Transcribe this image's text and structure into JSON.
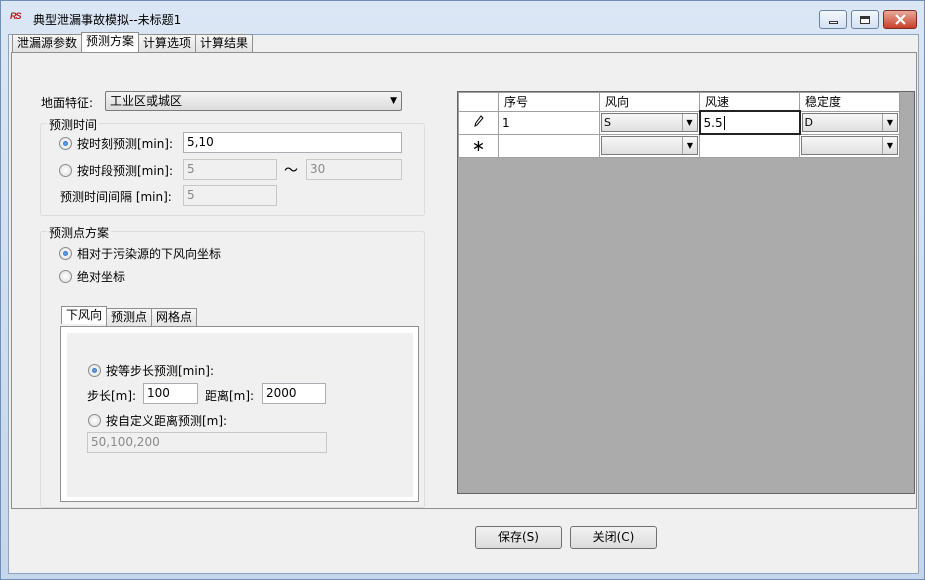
{
  "window": {
    "title": "典型泄漏事故模拟--未标题1",
    "app_icon_text": "RS",
    "controls": {
      "minimize": "minimize-icon",
      "maximize": "maximize-icon",
      "close": "close-icon"
    }
  },
  "tabs": [
    {
      "label": "泄漏源参数"
    },
    {
      "label": "预测方案"
    },
    {
      "label": "计算选项"
    },
    {
      "label": "计算结果"
    }
  ],
  "ground": {
    "label": "地面特征:",
    "value": "工业区或城区"
  },
  "time_group": {
    "title": "预测时间",
    "at_time": {
      "label": "按时刻预测[min]:",
      "value": "5,10",
      "checked": true
    },
    "period": {
      "label": "按时段预测[min]:",
      "from": "5",
      "tilde": "～",
      "to": "30"
    },
    "interval": {
      "label": "预测时间间隔 [min]:",
      "value": "5"
    }
  },
  "point_group": {
    "title": "预测点方案",
    "relative": {
      "label": "相对于污染源的下风向坐标",
      "checked": true
    },
    "absolute": {
      "label": "绝对坐标"
    }
  },
  "inner_tabs": [
    {
      "label": "下风向"
    },
    {
      "label": "预测点"
    },
    {
      "label": "网格点"
    }
  ],
  "downwind": {
    "equal_step": {
      "label": "按等步长预测[min]:",
      "checked": true
    },
    "step_label": "步长[m]:",
    "step_value": "100",
    "distance_label": "距离[m]:",
    "distance_value": "2000",
    "custom": {
      "label": "按自定义距离预测[m]:"
    },
    "custom_value": "50,100,200"
  },
  "grid": {
    "columns": [
      "序号",
      "风向",
      "风速",
      "稳定度"
    ],
    "rows": [
      {
        "marker": "pencil-icon",
        "no": "1",
        "direction": "S",
        "speed": "5.5",
        "stability": "D"
      },
      {
        "marker": "asterisk-icon",
        "no": "",
        "direction": "",
        "speed": "",
        "stability": ""
      }
    ]
  },
  "buttons": {
    "save": "保存(S)",
    "close": "关闭(C)"
  }
}
